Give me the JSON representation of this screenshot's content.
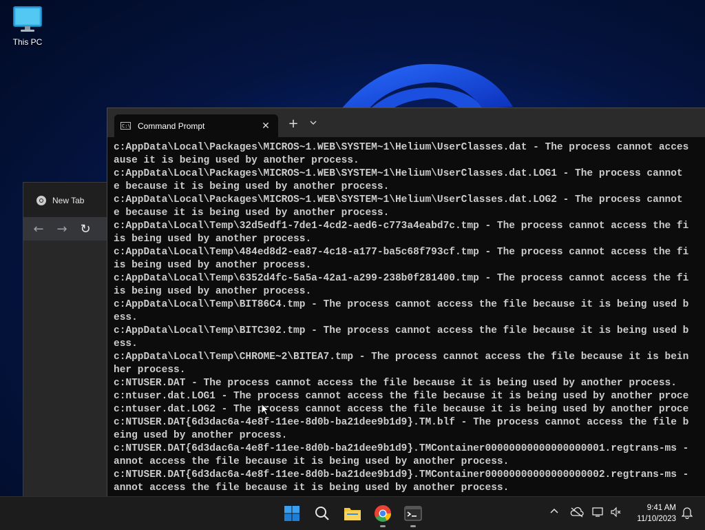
{
  "desktop": {
    "icons": [
      {
        "label": "This PC",
        "icon": "monitor-icon"
      }
    ]
  },
  "browser": {
    "tab_title": "New Tab",
    "nav": {
      "back": "←",
      "forward": "→",
      "reload": "↻"
    }
  },
  "terminal": {
    "tab_title": "Command Prompt",
    "close_glyph": "✕",
    "new_tab_glyph": "+",
    "dropdown_glyph": "⌄",
    "lines": [
      "c:AppData\\Local\\Packages\\MICROS~1.WEB\\SYSTEM~1\\Helium\\UserClasses.dat - The process cannot acces",
      "ause it is being used by another process.",
      "c:AppData\\Local\\Packages\\MICROS~1.WEB\\SYSTEM~1\\Helium\\UserClasses.dat.LOG1 - The process cannot",
      "e because it is being used by another process.",
      "c:AppData\\Local\\Packages\\MICROS~1.WEB\\SYSTEM~1\\Helium\\UserClasses.dat.LOG2 - The process cannot",
      "e because it is being used by another process.",
      "c:AppData\\Local\\Temp\\32d5edf1-7de1-4cd2-aed6-c773a4eabd7c.tmp - The process cannot access the fi",
      "is being used by another process.",
      "c:AppData\\Local\\Temp\\484ed8d2-ea87-4c18-a177-ba5c68f793cf.tmp - The process cannot access the fi",
      "is being used by another process.",
      "c:AppData\\Local\\Temp\\6352d4fc-5a5a-42a1-a299-238b0f281400.tmp - The process cannot access the fi",
      "is being used by another process.",
      "c:AppData\\Local\\Temp\\BIT86C4.tmp - The process cannot access the file because it is being used b",
      "ess.",
      "c:AppData\\Local\\Temp\\BITC302.tmp - The process cannot access the file because it is being used b",
      "ess.",
      "c:AppData\\Local\\Temp\\CHROME~2\\BITEA7.tmp - The process cannot access the file because it is bein",
      "her process.",
      "c:NTUSER.DAT - The process cannot access the file because it is being used by another process.",
      "c:ntuser.dat.LOG1 - The process cannot access the file because it is being used by another proce",
      "c:ntuser.dat.LOG2 - The process cannot access the file because it is being used by another proce",
      "c:NTUSER.DAT{6d3dac6a-4e8f-11ee-8d0b-ba21dee9b1d9}.TM.blf - The process cannot access the file b",
      "eing used by another process.",
      "c:NTUSER.DAT{6d3dac6a-4e8f-11ee-8d0b-ba21dee9b1d9}.TMContainer00000000000000000001.regtrans-ms -",
      "annot access the file because it is being used by another process.",
      "c:NTUSER.DAT{6d3dac6a-4e8f-11ee-8d0b-ba21dee9b1d9}.TMContainer00000000000000000002.regtrans-ms -",
      "annot access the file because it is being used by another process."
    ]
  },
  "taskbar": {
    "apps": [
      "start-icon",
      "search-icon",
      "file-explorer-icon",
      "chrome-icon",
      "terminal-icon"
    ],
    "tray_icons": [
      "chevron-up-icon",
      "onedrive-icon",
      "network-icon",
      "volume-icon"
    ],
    "time": "9:41 AM",
    "date": "11/10/2023",
    "colors": {
      "accent": "#0078d4",
      "chrome_red": "#ea4335",
      "chrome_green": "#34a853",
      "chrome_yellow": "#fbbc04",
      "chrome_blue": "#4285f4",
      "folder": "#f4c53d"
    }
  }
}
